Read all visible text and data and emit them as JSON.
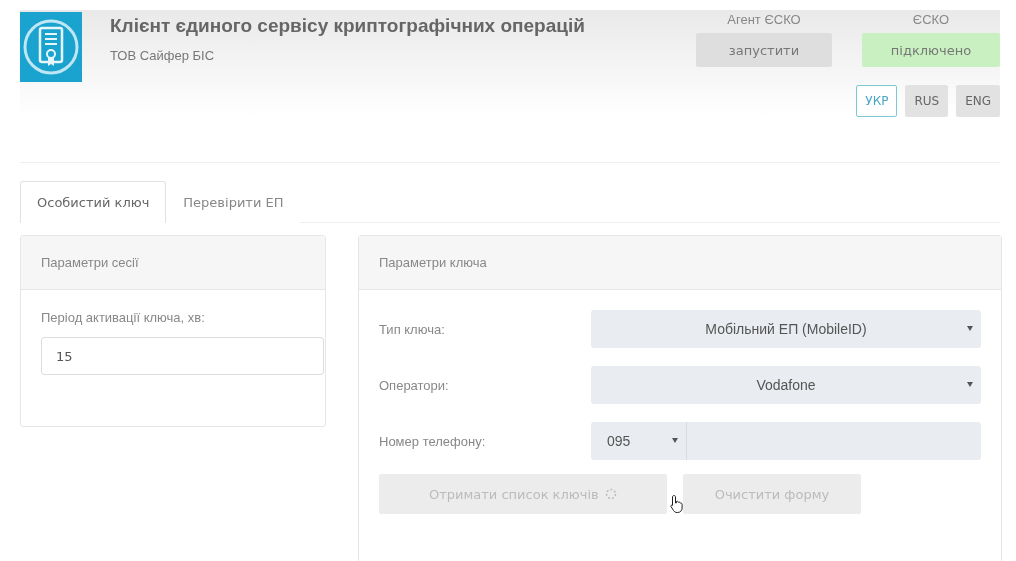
{
  "header": {
    "title": "Клієнт єдиного сервісу криптографічних операцій",
    "subtitle": "ТОВ Сайфер БІС",
    "services": [
      {
        "label": "Агент ЄСКО",
        "status": "запустити",
        "connected": false
      },
      {
        "label": "ЄСКО",
        "status": "підключено",
        "connected": true
      }
    ],
    "languages": [
      {
        "label": "УКР",
        "selected": true
      },
      {
        "label": "RUS",
        "selected": false
      },
      {
        "label": "ENG",
        "selected": false
      }
    ]
  },
  "tabs": [
    {
      "label": "Особистий ключ",
      "selected": true
    },
    {
      "label": "Перевірити ЕП",
      "selected": false
    }
  ],
  "session_panel": {
    "title": "Параметри сесії",
    "field_label": "Період активації ключа, хв:",
    "value": "15"
  },
  "key_panel": {
    "title": "Параметри ключа",
    "fields": [
      {
        "kind": "select",
        "label": "Тип ключа:",
        "value": "Мобільний ЕП (MobileID)"
      },
      {
        "kind": "select",
        "label": "Оператори:",
        "value": "Vodafone"
      },
      {
        "kind": "phone",
        "label": "Номер телефону:",
        "value": "095"
      }
    ],
    "buttons": [
      {
        "label": "Отримати список ключів",
        "disabled": true,
        "loading": true
      },
      {
        "label": "Очистити форму",
        "disabled": true,
        "loading": false
      }
    ]
  }
}
